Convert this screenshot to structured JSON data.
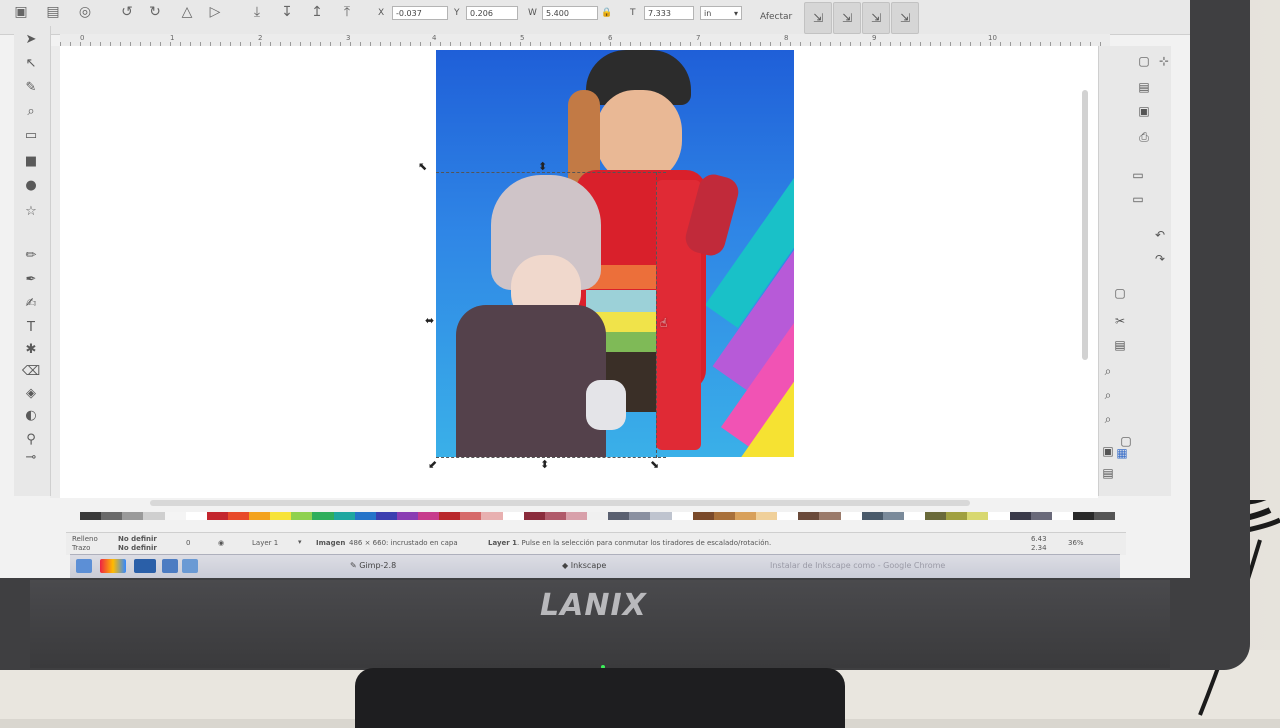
{
  "toolbar": {
    "x_label": "X",
    "x_value": "-0.037",
    "y_label": "Y",
    "y_value": "0.206",
    "w_label": "W",
    "w_value": "5.400",
    "h_label": "T",
    "h_value": "7.333",
    "unit": "in",
    "affect_label": "Afectar"
  },
  "ruler": {
    "ticks": [
      "0",
      "1",
      "2",
      "3",
      "4",
      "5",
      "6",
      "7",
      "8",
      "9",
      "10"
    ]
  },
  "status": {
    "fill_label": "Relleno",
    "fill_value": "No definir",
    "stroke_label": "Trazo",
    "stroke_value": "No definir",
    "opacity_value": "0",
    "layer": "Layer 1",
    "message_bold": "Imagen",
    "message": "486 × 660: incrustado en capa",
    "message_layer": "Layer 1",
    "message_tail": ". Pulse en la selección para conmutar los tiradores de escalado/rotación.",
    "coord_x": "6.43",
    "coord_y": "2.34",
    "zoom": "36%"
  },
  "taskbar": {
    "gimp": "Gimp-2.8",
    "inkscape": "Inkscape",
    "chrome": "Instalar de Inkscape como - Google Chrome"
  },
  "monitor": {
    "brand": "LANIX"
  },
  "palette_colors": [
    "#3a3a3a",
    "#6a6a6a",
    "#9a9a9a",
    "#cfcfcf",
    "#f4f4f4",
    "#ffffff",
    "#c3262e",
    "#e84a2a",
    "#f3a21d",
    "#f7e338",
    "#8fd14f",
    "#2fae5c",
    "#1ea7a0",
    "#2574c9",
    "#3c3fb0",
    "#8a3db3",
    "#c73b8c",
    "#b9282c",
    "#d66a6a",
    "#e8b0b0",
    "#ffffff",
    "#8a2c3c",
    "#b05a6a",
    "#d8a0aa",
    "#f0f0f0",
    "#5a6070",
    "#8a90a0",
    "#bfc4cf",
    "#ffffff",
    "#7a4a2a",
    "#a8703a",
    "#d8a05a",
    "#f0d09a",
    "#ffffff",
    "#6a4a3a",
    "#9a7a6a",
    "#ffffff",
    "#4a5a6a",
    "#7a8a9a",
    "#ffffff",
    "#6a6a3a",
    "#a0a040",
    "#d8d870",
    "#ffffff",
    "#3a3a4a",
    "#6a6a7a",
    "#ffffff",
    "#2a2a2a",
    "#555555"
  ]
}
